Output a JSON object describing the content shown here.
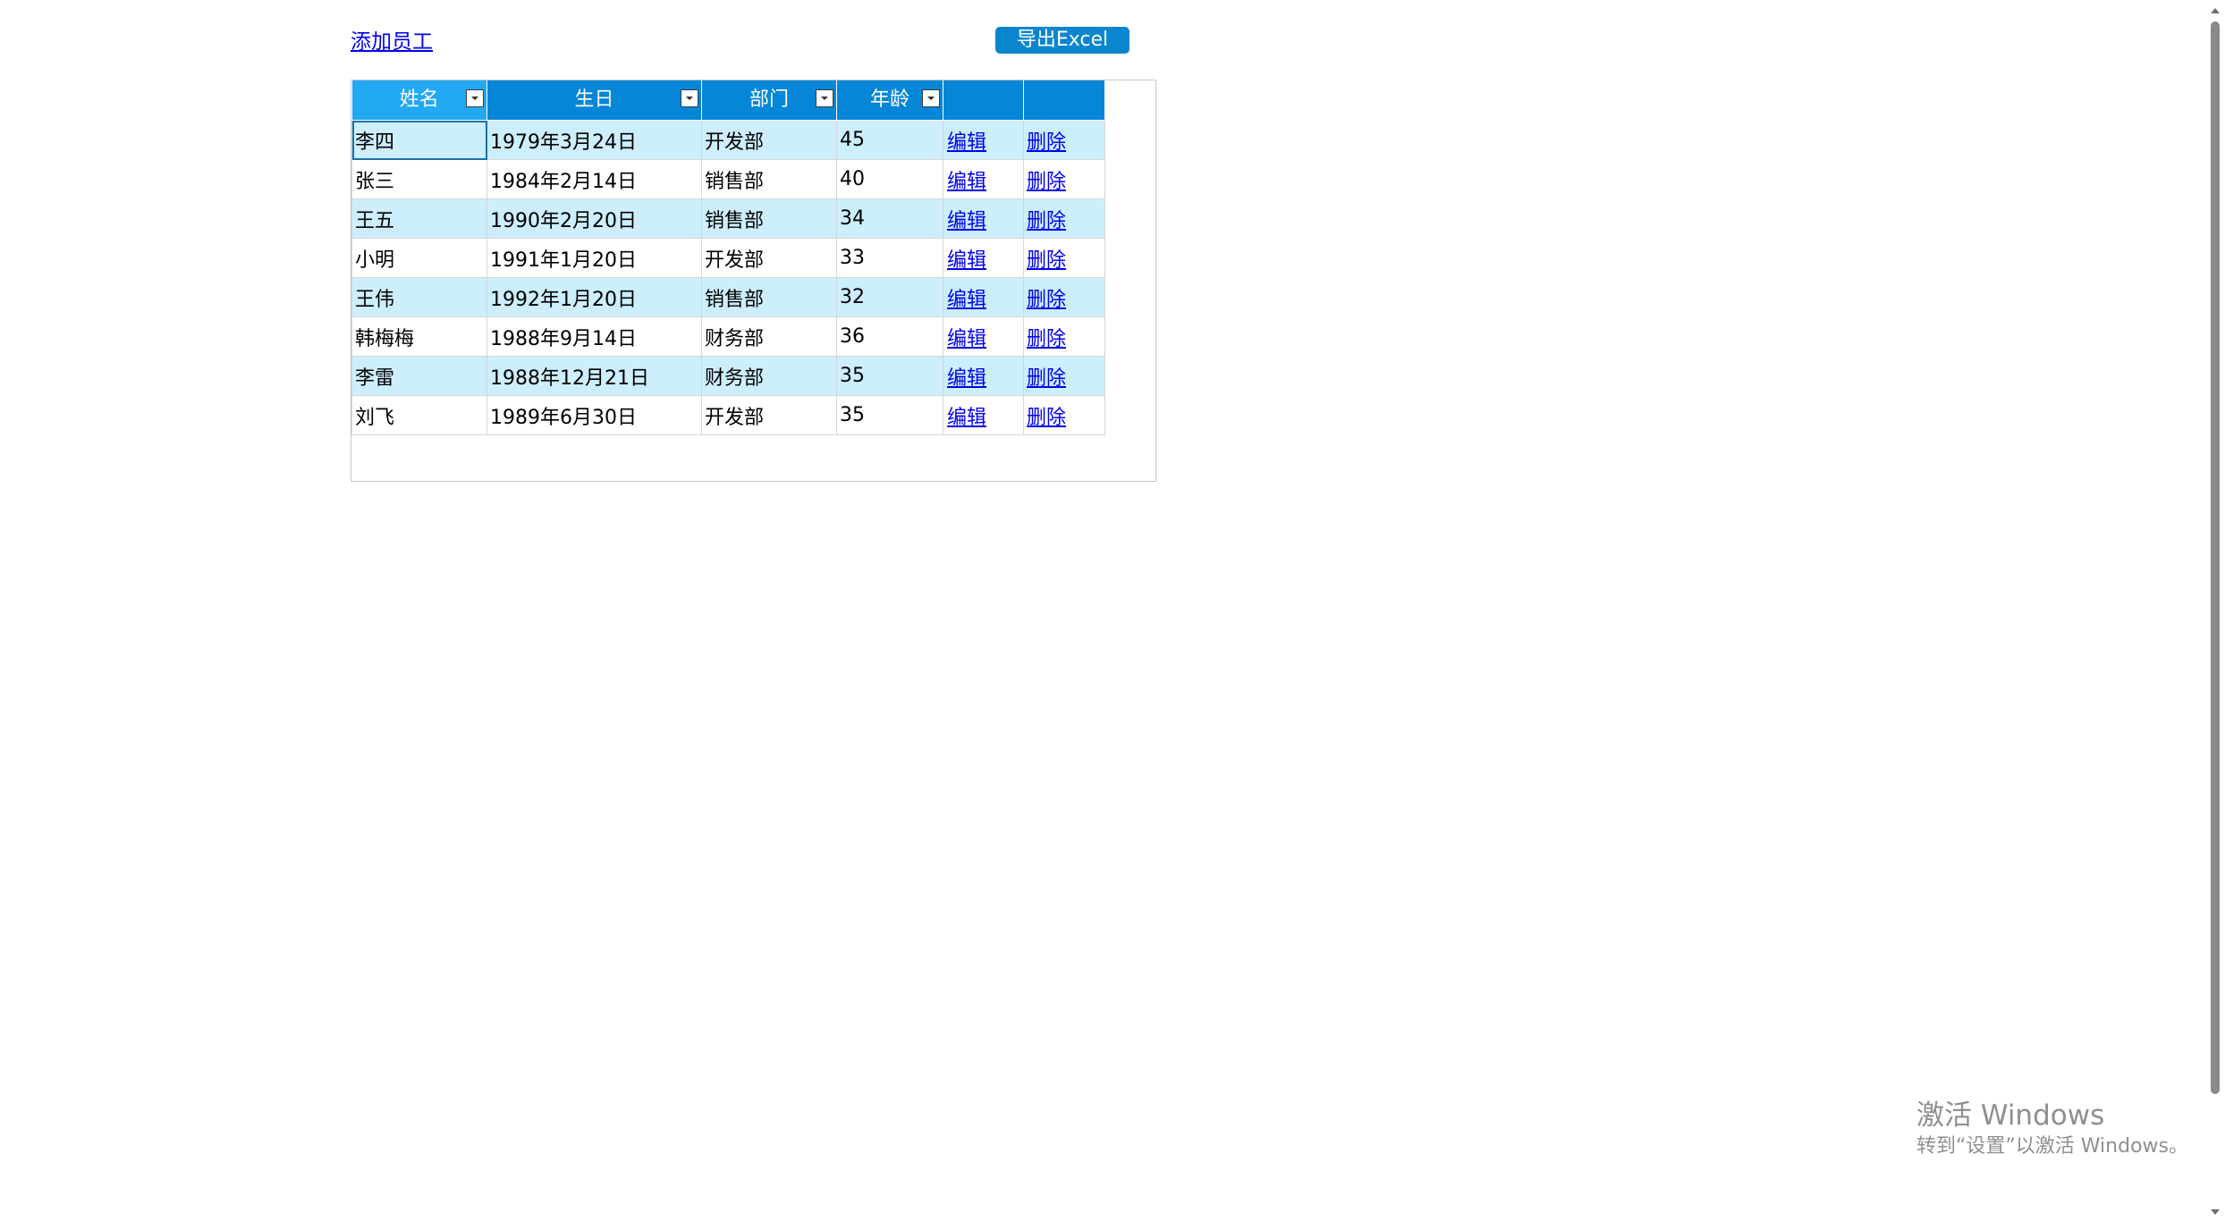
{
  "toolbar": {
    "add_employee_label": "添加员工",
    "export_label": "导出Excel"
  },
  "colors": {
    "header_bg": "#0586d6",
    "header_first_bg": "#23a8f2",
    "row_alt_bg": "#cdeefc",
    "button_bg": "#0a86cf",
    "link": "#0000ee"
  },
  "grid": {
    "columns": [
      {
        "label": "姓名",
        "filterable": true
      },
      {
        "label": "生日",
        "filterable": true
      },
      {
        "label": "部门",
        "filterable": true
      },
      {
        "label": "年龄",
        "filterable": true
      },
      {
        "label": "",
        "filterable": false
      },
      {
        "label": "",
        "filterable": false
      }
    ],
    "rows": [
      {
        "name": "李四",
        "birthday": "1979年3月24日",
        "dept": "开发部",
        "age": "45",
        "edit": "编辑",
        "delete": "删除"
      },
      {
        "name": "张三",
        "birthday": "1984年2月14日",
        "dept": "销售部",
        "age": "40",
        "edit": "编辑",
        "delete": "删除"
      },
      {
        "name": "王五",
        "birthday": "1990年2月20日",
        "dept": "销售部",
        "age": "34",
        "edit": "编辑",
        "delete": "删除"
      },
      {
        "name": "小明",
        "birthday": "1991年1月20日",
        "dept": "开发部",
        "age": "33",
        "edit": "编辑",
        "delete": "删除"
      },
      {
        "name": "王伟",
        "birthday": "1992年1月20日",
        "dept": "销售部",
        "age": "32",
        "edit": "编辑",
        "delete": "删除"
      },
      {
        "name": "韩梅梅",
        "birthday": "1988年9月14日",
        "dept": "财务部",
        "age": "36",
        "edit": "编辑",
        "delete": "删除"
      },
      {
        "name": "李雷",
        "birthday": "1988年12月21日",
        "dept": "财务部",
        "age": "35",
        "edit": "编辑",
        "delete": "删除"
      },
      {
        "name": "刘飞",
        "birthday": "1989年6月30日",
        "dept": "开发部",
        "age": "35",
        "edit": "编辑",
        "delete": "删除"
      }
    ]
  },
  "watermark": {
    "title": "激活 Windows",
    "subtitle": "转到“设置”以激活 Windows。"
  },
  "icons": {
    "filter": "filter-dropdown-icon",
    "scroll_up": "scroll-up-arrow-icon",
    "scroll_down": "scroll-down-arrow-icon"
  }
}
